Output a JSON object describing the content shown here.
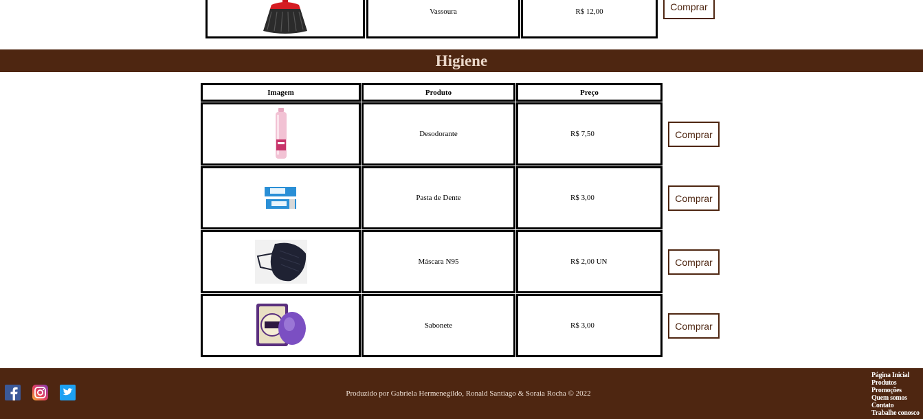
{
  "previous_section": {
    "rows": [
      {
        "image_icon": "broom-icon",
        "produto": "Vassoura",
        "preco": "R$ 12,00",
        "button": "Comprar"
      }
    ]
  },
  "section": {
    "title": "Higiene",
    "headers": {
      "imagem": "Imagem",
      "produto": "Produto",
      "preco": "Preço"
    },
    "rows": [
      {
        "image_icon": "deodorant-icon",
        "produto": "Desodorante",
        "preco": "R$ 7,50",
        "button": "Comprar"
      },
      {
        "image_icon": "toothpaste-icon",
        "produto": "Pasta de Dente",
        "preco": "R$ 3,00",
        "button": "Comprar"
      },
      {
        "image_icon": "mask-icon",
        "produto": "Máscara N95",
        "preco": "R$ 2,00 UN",
        "button": "Comprar"
      },
      {
        "image_icon": "soap-icon",
        "produto": "Sabonete",
        "preco": "R$ 3,00",
        "button": "Comprar"
      }
    ]
  },
  "footer": {
    "credit": "Produzido por Gabriela Hermenegildo, Ronald Santiago & Soraia Rocha © 2022",
    "social": [
      "facebook-icon",
      "instagram-icon",
      "twitter-icon"
    ],
    "links": [
      "Página Inicial",
      "Produtos",
      "Promoções",
      "Quem somos",
      "Contato",
      "Trabalhe conosco"
    ]
  },
  "colors": {
    "brand": "#4e2611",
    "title": "#e9d6c8"
  }
}
